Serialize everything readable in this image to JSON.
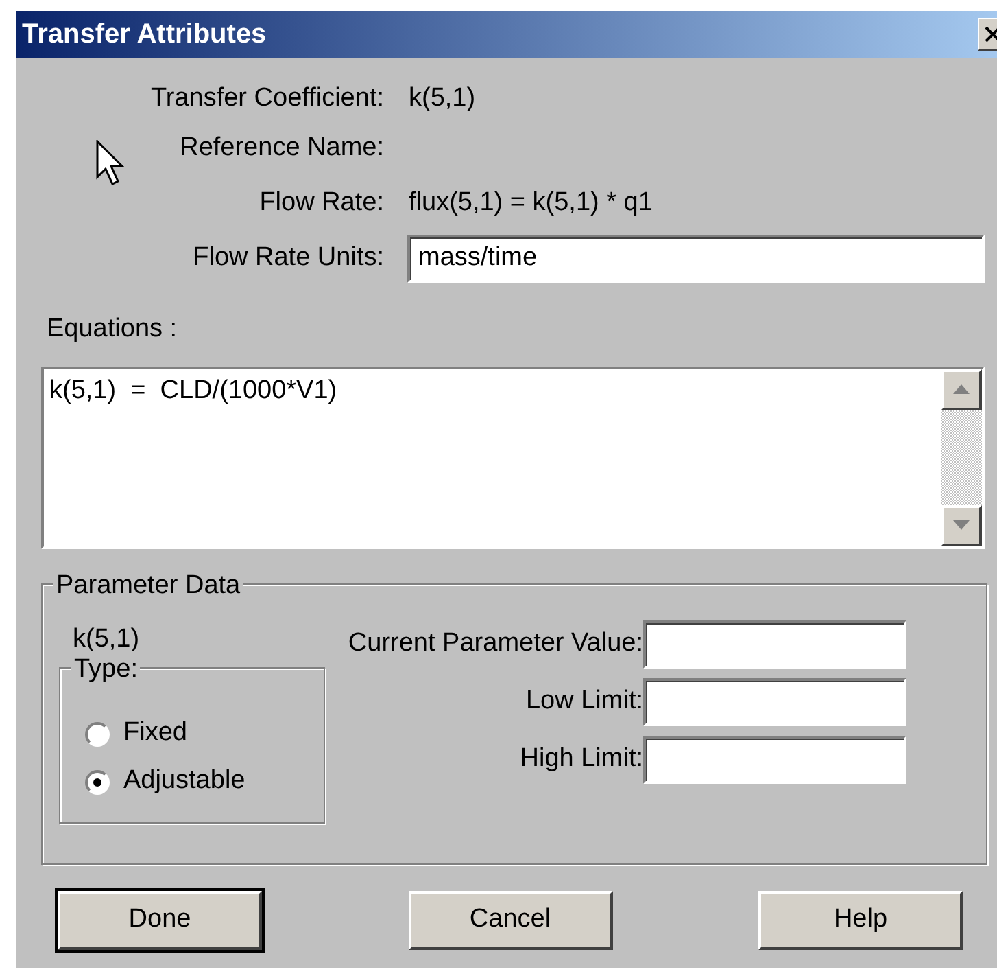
{
  "window": {
    "title": "Transfer Attributes"
  },
  "info": [
    {
      "label": "Transfer Coefficient:",
      "value": "k(5,1)",
      "kind": "text"
    },
    {
      "label": "Reference Name:",
      "kind": "text"
    },
    {
      "label": "Flow Rate:",
      "value": "flux(5,1) = k(5,1) * q1",
      "kind": "text"
    },
    {
      "label": "Flow Rate Units:",
      "value": "mass/time",
      "kind": "field"
    }
  ],
  "equations": {
    "label": "Equations :",
    "text": "k(5,1)  =  CLD/(1000*V1)"
  },
  "parameter_data": {
    "title": "Parameter Data",
    "name": "k(5,1)",
    "type": {
      "title": "Type:",
      "options": [
        {
          "label": "Fixed",
          "selected": false
        },
        {
          "label": "Adjustable",
          "selected": true
        }
      ]
    },
    "fields": [
      {
        "label": "Current Parameter Value:"
      },
      {
        "label": "Low Limit:"
      },
      {
        "label": "High Limit:"
      }
    ]
  },
  "buttons": [
    {
      "label": "Done",
      "default": true
    },
    {
      "label": "Cancel",
      "default": false
    },
    {
      "label": "Help",
      "default": false
    }
  ]
}
